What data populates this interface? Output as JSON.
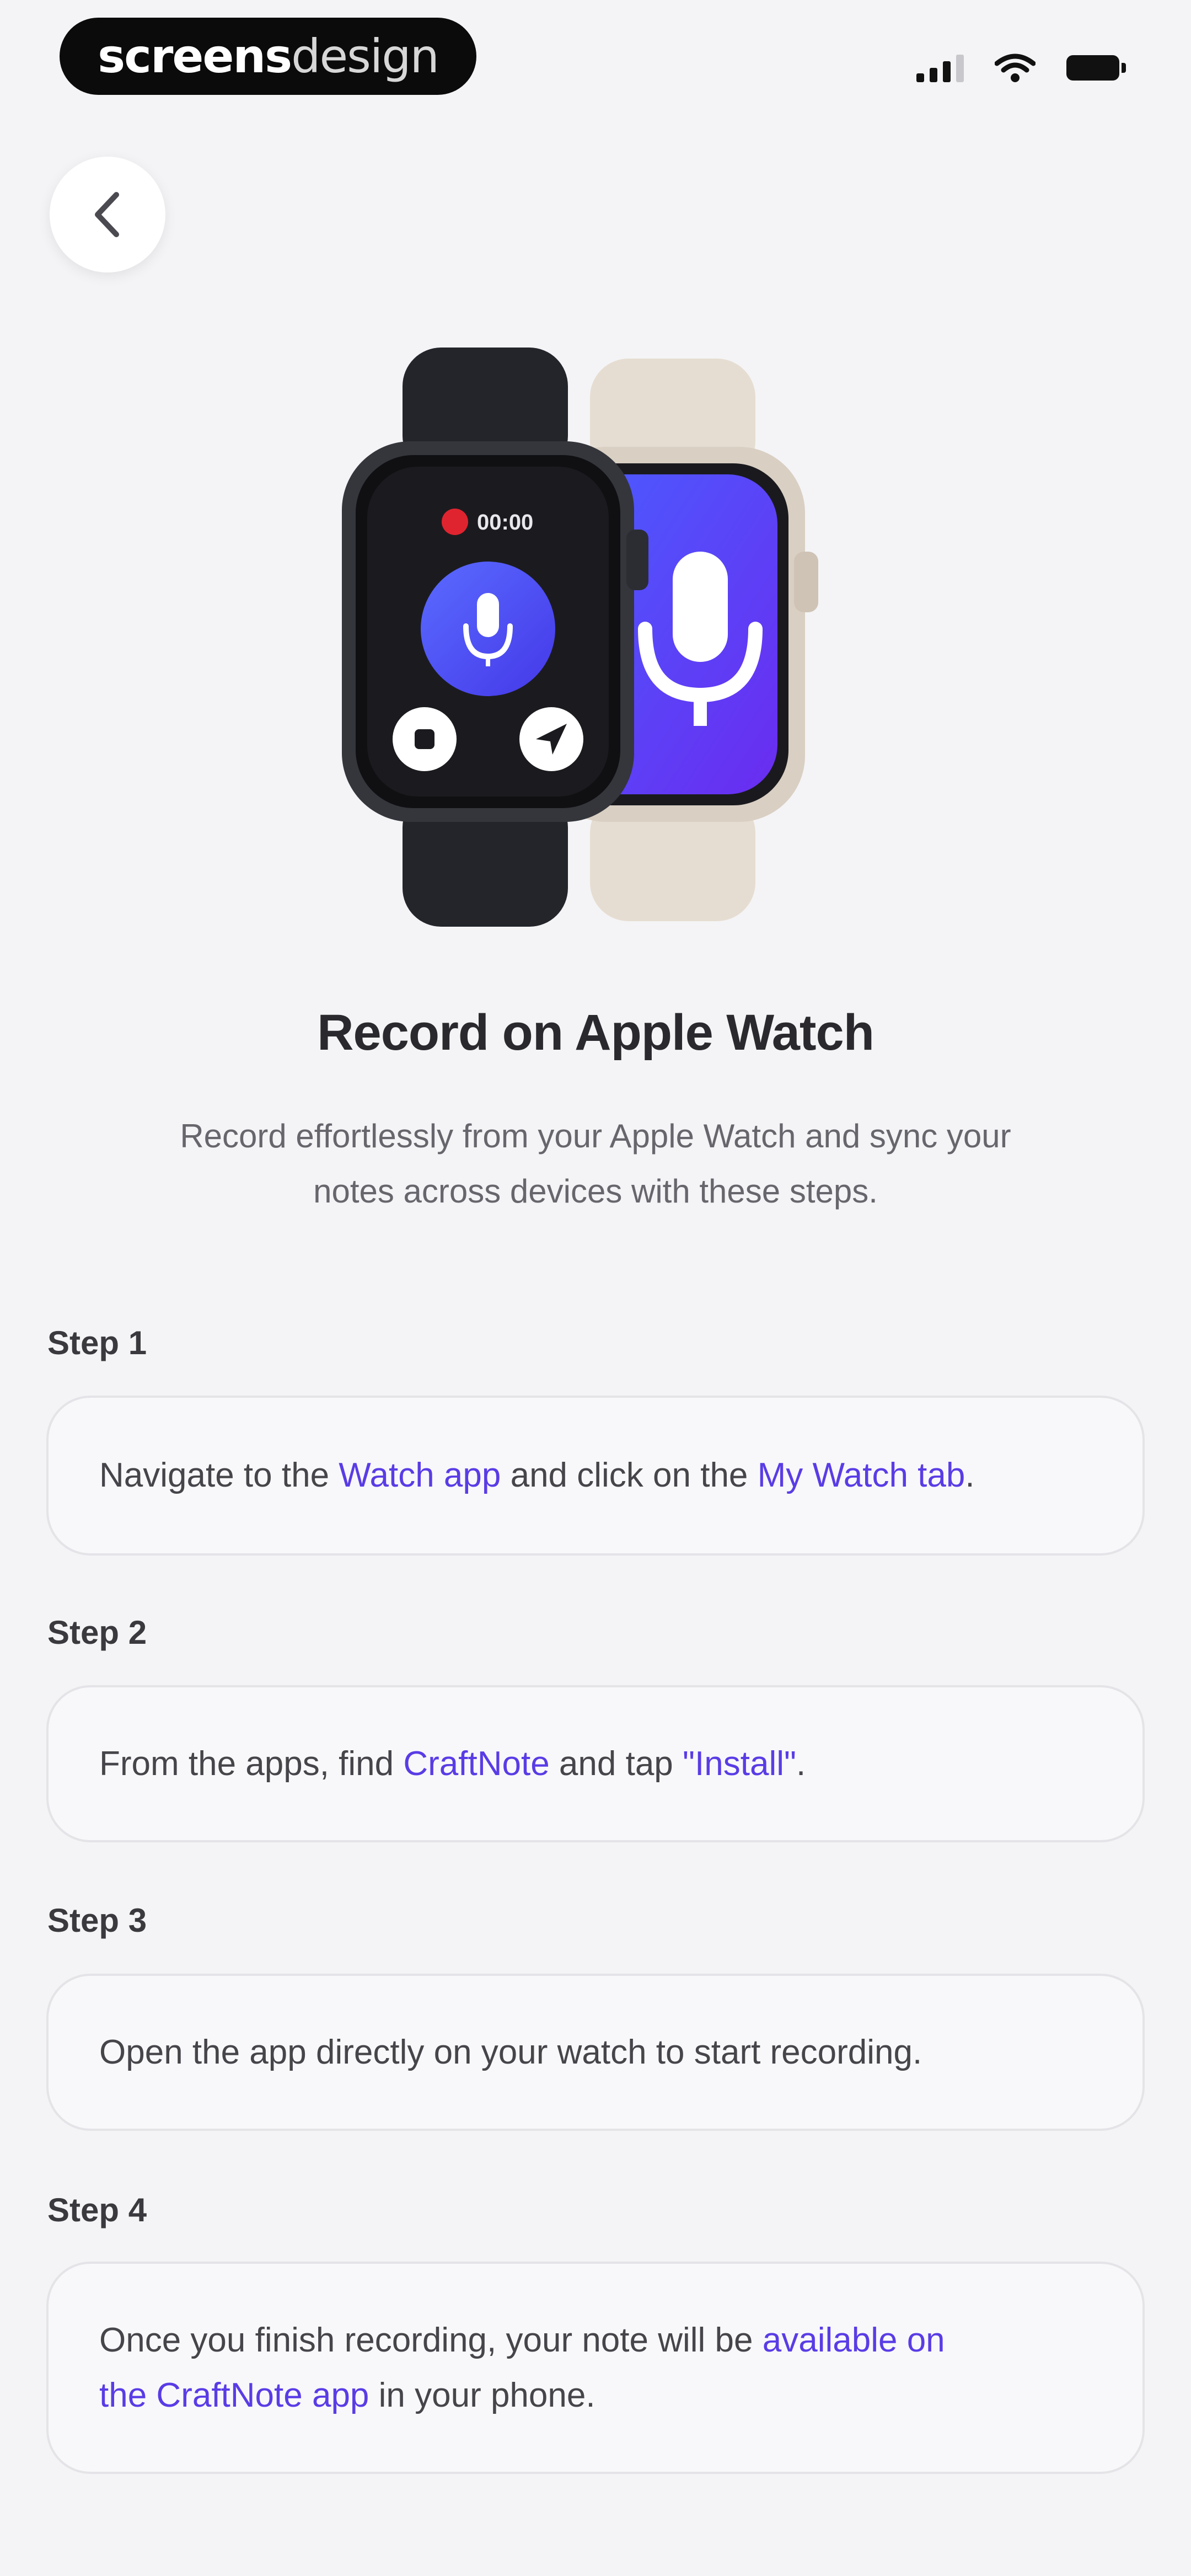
{
  "status_bar": {
    "brand_strong": "screens",
    "brand_light": "design"
  },
  "icons": {
    "back": "chevron-left-icon",
    "signal": "cellular-signal-icon",
    "wifi": "wifi-icon",
    "battery": "battery-icon",
    "mic": "microphone-icon",
    "stop": "stop-icon",
    "send": "send-arrow-icon"
  },
  "colors": {
    "accent": "#5a3ce6",
    "record_red": "#e0242f",
    "watch_dark": "#1f2126",
    "watch_light": "#e6ddd2",
    "background": "#f4f4f6"
  },
  "hero": {
    "timer": "00:00"
  },
  "page": {
    "title": "Record on Apple Watch",
    "subtitle_line1": "Record effortlessly from your Apple Watch and sync your",
    "subtitle_line2": "notes across devices with these steps."
  },
  "steps": [
    {
      "label": "Step 1",
      "t1": "Navigate to the ",
      "l1": "Watch app",
      "t2": " and click on the ",
      "l2": "My Watch tab",
      "t3": "."
    },
    {
      "label": "Step 2",
      "t1": "From the apps, find ",
      "l1": "CraftNote",
      "t2": " and tap ",
      "l2": "\"Install\"",
      "t3": "."
    },
    {
      "label": "Step 3",
      "t1": "Open the app directly on your watch to start recording."
    },
    {
      "label": "Step 4",
      "t1": "Once you finish recording, your note will be ",
      "l1": "available on",
      "l1b": "the CraftNote app",
      "t2": " in your phone."
    }
  ]
}
